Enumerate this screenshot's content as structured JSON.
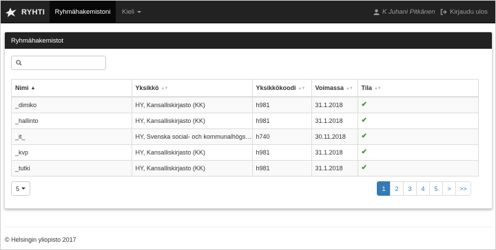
{
  "navbar": {
    "brand": "RYHTI",
    "active_item": "Ryhmähakemistoni",
    "lang_menu": "Kieli",
    "user": "K Juhani Pitkänen",
    "logout": "Kirjaudu ulos"
  },
  "panel": {
    "title": "Ryhmähakemistot",
    "search": {
      "value": "",
      "placeholder": ""
    }
  },
  "table": {
    "columns": [
      "Nimi",
      "Yksikkö",
      "Yksikkökoodi",
      "Voimassa",
      "Tila"
    ],
    "sorted_column": "Nimi",
    "rows": [
      {
        "name": "_dimiko",
        "unit": "HY, Kansalliskirjasto (KK)",
        "code": "h981",
        "valid": "31.1.2018",
        "status": "ok"
      },
      {
        "name": "_hallinto",
        "unit": "HY, Kansalliskirjasto (KK)",
        "code": "h981",
        "valid": "31.1.2018",
        "status": "ok"
      },
      {
        "name": "_it_",
        "unit": "HY, Svenska social- och kommunalhögs…",
        "code": "h740",
        "valid": "30.11.2018",
        "status": "ok"
      },
      {
        "name": "_kvp",
        "unit": "HY, Kansalliskirjasto (KK)",
        "code": "h981",
        "valid": "31.1.2018",
        "status": "ok"
      },
      {
        "name": "_tutki",
        "unit": "HY, Kansalliskirjasto (KK)",
        "code": "h981",
        "valid": "31.1.2018",
        "status": "ok"
      }
    ]
  },
  "pagination": {
    "page_size": "5",
    "pages": [
      "1",
      "2",
      "3",
      "4",
      "5"
    ],
    "active_page": "1",
    "next": ">",
    "last": ">>"
  },
  "footer": {
    "text": "© Helsingin yliopisto 2017"
  },
  "colors": {
    "navbar": "#222222",
    "link": "#337ab7",
    "ok": "#3c9a2b"
  }
}
